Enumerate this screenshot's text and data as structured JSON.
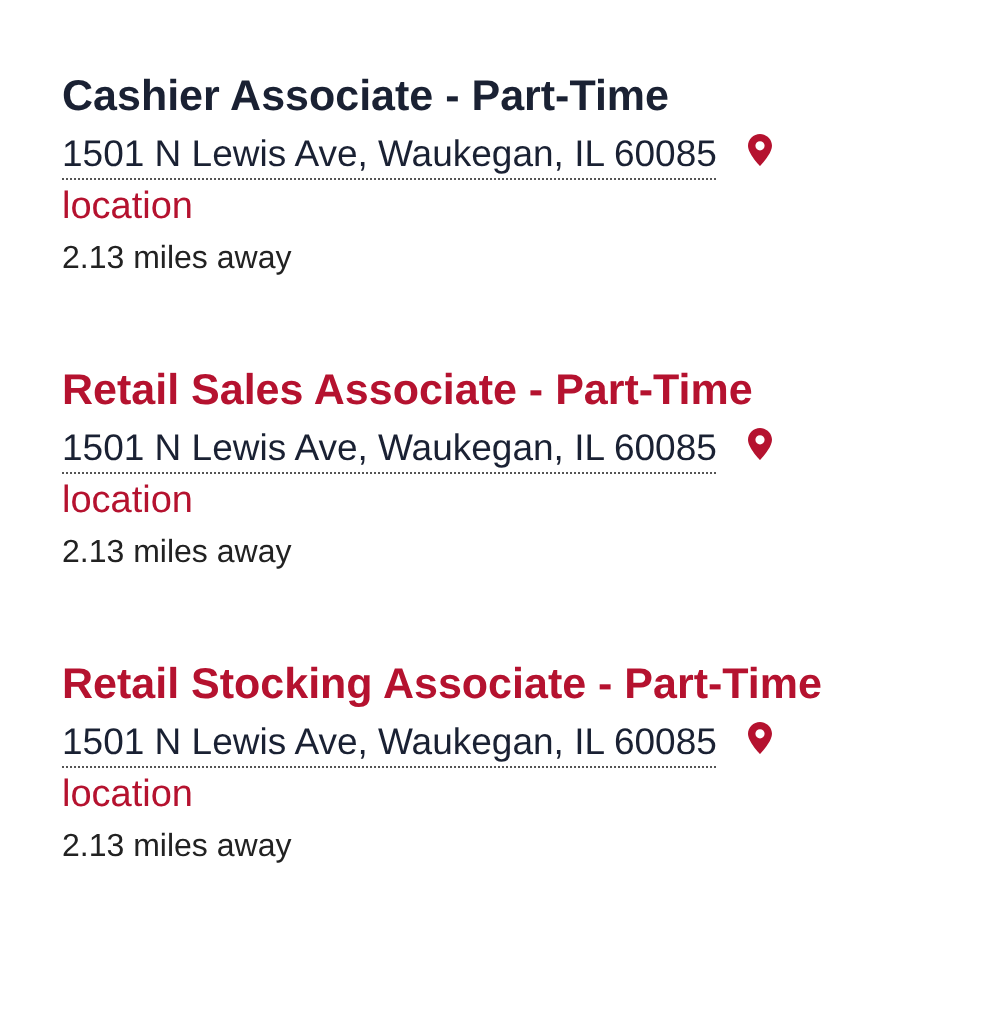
{
  "jobs": [
    {
      "title": "Cashier Associate - Part-Time",
      "visited": true,
      "address": "1501 N Lewis Ave, Waukegan, IL 60085",
      "location_label": "location",
      "distance": "2.13 miles away"
    },
    {
      "title": "Retail Sales Associate - Part-Time",
      "visited": false,
      "address": "1501 N Lewis Ave, Waukegan, IL 60085",
      "location_label": "location",
      "distance": "2.13 miles away"
    },
    {
      "title": "Retail Stocking Associate - Part-Time",
      "visited": false,
      "address": "1501 N Lewis Ave, Waukegan, IL 60085",
      "location_label": "location",
      "distance": "2.13 miles away"
    }
  ]
}
